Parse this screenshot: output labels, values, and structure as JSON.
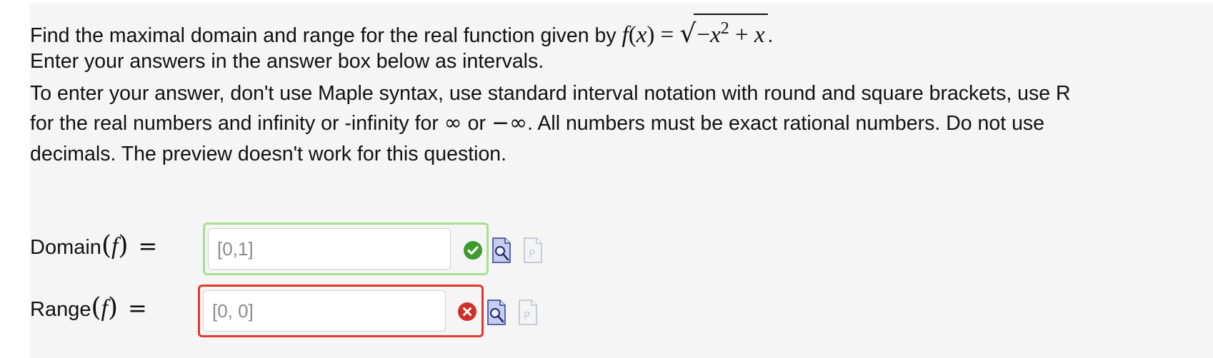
{
  "question": {
    "intro_prefix": "Find the maximal domain and range for the real function given by ",
    "fn_name": "f",
    "fn_arg": "(x)",
    "fn_eq": " = ",
    "radicand_minus": "−",
    "radicand_var": "x",
    "radicand_exp": "2",
    "radicand_rest": " + x",
    "intro_suffix": ".",
    "line2": "Enter your answers in the answer box below as intervals.",
    "line3": "To enter your answer, don't use Maple syntax, use standard interval notation with round and square brackets, use R",
    "line4_a": "for the real numbers and infinity or -infinity for ",
    "line4_inf": "∞",
    "line4_b": " or ",
    "line4_neginf": "−∞",
    "line4_c": ".  All numbers must be exact rational numbers.  Do not use",
    "line5": "decimals.  The preview doesn't work for this question."
  },
  "answers": [
    {
      "label_word": "Domain",
      "label_open": "(",
      "label_fn": "f",
      "label_close": ")",
      "label_eq": "=",
      "value": "[0,1]",
      "status": "correct"
    },
    {
      "label_word": "Range",
      "label_open": "(",
      "label_fn": "f",
      "label_close": ")",
      "label_eq": "=",
      "value": "[0, 0]",
      "status": "incorrect"
    }
  ],
  "icons": {
    "correct": "checkmark-icon",
    "incorrect": "cross-icon",
    "preview": "preview-magnifier-icon",
    "maple": "maple-document-icon"
  },
  "colors": {
    "correct_border": "#a7e08e",
    "correct_badge": "#3f9a2c",
    "incorrect_border": "#e0382e",
    "incorrect_badge": "#cf2f2a",
    "panel_bg": "#f5f5f5"
  }
}
